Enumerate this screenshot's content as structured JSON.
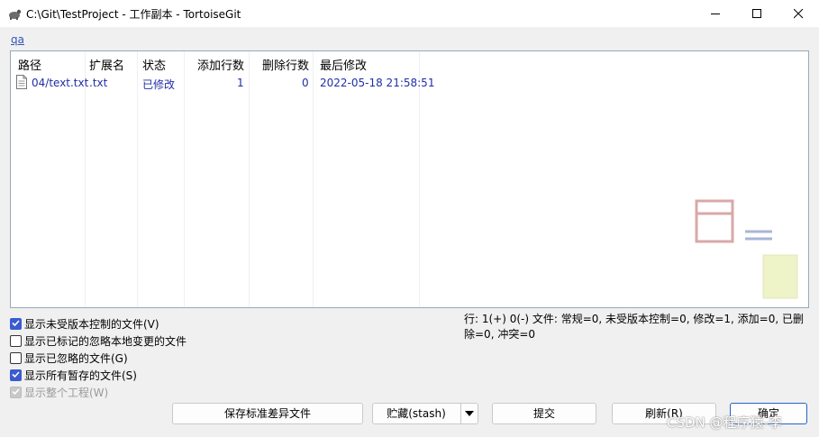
{
  "window": {
    "title": "C:\\Git\\TestProject - 工作副本 - TortoiseGit",
    "controls": {
      "minimize": "minimize-icon",
      "maximize": "maximize-icon",
      "close": "close-icon"
    }
  },
  "branch_link": "qa",
  "file_list": {
    "columns": [
      "路径",
      "扩展名",
      "状态",
      "添加行数",
      "删除行数",
      "最后修改"
    ],
    "rows": [
      {
        "path": "04/text.txt",
        "ext": ".txt",
        "status": "已修改",
        "added": "1",
        "deleted": "0",
        "modified": "2022-05-18 21:58:51"
      }
    ]
  },
  "status_text": "行: 1(+) 0(-) 文件: 常规=0, 未受版本控制=0, 修改=1, 添加=0, 已删除=0, 冲突=0",
  "checkboxes": [
    {
      "label": "显示未受版本控制的文件(V)",
      "checked": true,
      "disabled": false
    },
    {
      "label": "显示已标记的忽略本地变更的文件",
      "checked": false,
      "disabled": false
    },
    {
      "label": "显示已忽略的文件(G)",
      "checked": false,
      "disabled": false
    },
    {
      "label": "显示所有暂存的文件(S)",
      "checked": true,
      "disabled": false
    },
    {
      "label": "显示整个工程(W)",
      "checked": true,
      "disabled": true
    }
  ],
  "buttons": {
    "save_diff": "保存标准差异文件",
    "stash": "贮藏(stash)",
    "commit": "提交",
    "refresh": "刷新(R)",
    "ok": "确定"
  },
  "watermark": "CSDN @程序猿-李",
  "colors": {
    "accent": "#3b5bd0",
    "link": "#3355bb",
    "list_text": "#1f2fa8"
  }
}
